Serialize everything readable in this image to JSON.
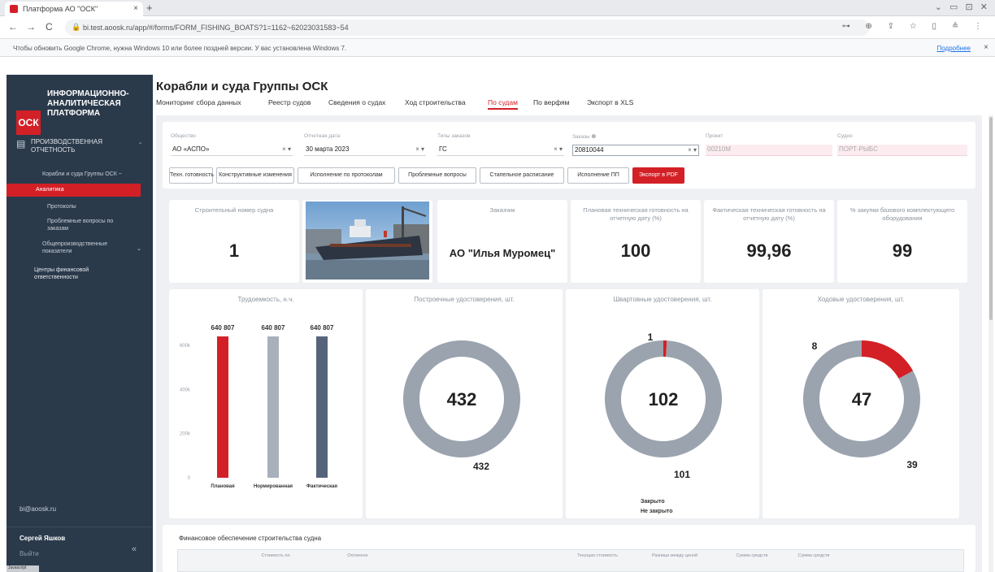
{
  "browser": {
    "tab_title": "Платформа АО \"ОСК\"",
    "tab_close": "×",
    "new_tab": "+",
    "window_controls": "⌄ ▭ ⊡ ✕",
    "back": "←",
    "forward": "→",
    "reload": "C",
    "url": "bi.test.aoosk.ru/app/#/forms/FORM_FISHING_BOATS?1=1162~62023031583~54",
    "toolbar_icons": "⊶ ⊕ ⇪ ☆ ▯ ≗ ⋮",
    "infobar_message": "Чтобы обновить Google Chrome, нужна Windows 10 или более поздней версии. У вас установлена Windows 7.",
    "infobar_more": "Подробнее",
    "infobar_close": "×"
  },
  "sidebar": {
    "logo_mark": "ОСК",
    "logo_text": "ИНФОРМАЦИОННО-АНАЛИТИЧЕСКАЯ ПЛАТФОРМА",
    "section_label": "ПРОИЗВОДСТВЕННАЯ ОТЧЕТНОСТЬ",
    "items": [
      {
        "label": "Корабли и суда Группы ОСК ~"
      },
      {
        "label": "Аналитика"
      },
      {
        "label": "Протоколы"
      },
      {
        "label": "Проблемные вопросы по заказам"
      },
      {
        "label": "Общепроизводственные показатели"
      },
      {
        "label": "Центры финансовой ответственности"
      }
    ],
    "email": "bi@aoosk.ru",
    "user_name": "Сергей Яшков",
    "logout": "Выйти",
    "collapse": "«",
    "footer_tag": "Javascript"
  },
  "header": {
    "title": "Корабли и суда Группы ОСК",
    "tabs": [
      {
        "label": "Мониторинг сбора данных"
      },
      {
        "label": "Реестр судов"
      },
      {
        "label": "Сведения о судах"
      },
      {
        "label": "Ход строительства"
      },
      {
        "label": "По судам"
      },
      {
        "label": "По верфям"
      },
      {
        "label": "Экспорт в XLS"
      }
    ],
    "active_tab": "По судам"
  },
  "filters": {
    "fields": [
      {
        "label": "Общество",
        "value": "АО «АСПО»",
        "controls": "×  ▾"
      },
      {
        "label": "Отчетная дата",
        "value": "30 марта 2023",
        "controls": "×  ▾"
      },
      {
        "label": "Типы заказов",
        "value": "ГС",
        "controls": "×  ▾"
      },
      {
        "label": "Заказы ❷",
        "value": "20810044",
        "controls": "×  ▾"
      },
      {
        "label": "Проект",
        "value": "00210М",
        "controls": ""
      },
      {
        "label": "Судно",
        "value": "ПОРТ-РЫБС",
        "controls": ""
      }
    ],
    "buttons": [
      {
        "label": "Техн. готовность"
      },
      {
        "label": "Конструктивные изменения"
      },
      {
        "label": "Исполнение по протоколам"
      },
      {
        "label": "Проблемные вопросы"
      },
      {
        "label": "Стапельное расписание"
      },
      {
        "label": "Исполнение ПП"
      },
      {
        "label": "Экспорт в PDF"
      }
    ]
  },
  "kpis": [
    {
      "label": "Строительный номер судна",
      "value": "1"
    },
    {
      "label": "Заказчик",
      "value": "АО \"Илья Муромец\""
    },
    {
      "label": "Плановая техническая готовность на отчетную дату (%)",
      "value": "100"
    },
    {
      "label": "Фактическая техническая готовность на отчетную дату (%)",
      "value": "99,96"
    },
    {
      "label": "% закупки базового комплектующего оборудования",
      "value": "99"
    }
  ],
  "colors": {
    "accent_red": "#d32027",
    "sidebar_bg": "#2b3a4b",
    "donut_grey": "#9aa3ae",
    "bar_grey": "#a7b0bb",
    "bar_dark": "#55647a"
  },
  "chart_data": [
    {
      "type": "bar",
      "title": "Трудоемкость, н.ч.",
      "categories": [
        "Плановая",
        "Нормированная",
        "Фактическая"
      ],
      "values": [
        640807,
        640807,
        640807
      ],
      "value_labels": [
        "640 807",
        "640 807",
        "640 807"
      ],
      "colors": [
        "#d32027",
        "#a7b0bb",
        "#55647a"
      ],
      "yticks": [
        0,
        200000,
        400000,
        600000
      ],
      "ytick_labels": [
        "0",
        "200k",
        "400k",
        "600k"
      ],
      "ylim": [
        0,
        700000
      ]
    },
    {
      "type": "pie",
      "title": "Построечные удостоверения, шт.",
      "center_label": "432",
      "slices": [
        {
          "name": "Закрыто",
          "value": 0,
          "label": "0",
          "color": "#d32027"
        },
        {
          "name": "Не закрыто",
          "value": 432,
          "label": "432",
          "color": "#9aa3ae"
        }
      ]
    },
    {
      "type": "pie",
      "title": "Швартовные удостоверения, шт.",
      "center_label": "102",
      "slices": [
        {
          "name": "Закрыто",
          "value": 1,
          "label": "1",
          "color": "#d32027"
        },
        {
          "name": "Не закрыто",
          "value": 101,
          "label": "101",
          "color": "#9aa3ae"
        }
      ],
      "legend": [
        "Закрыто",
        "Не закрыто"
      ]
    },
    {
      "type": "pie",
      "title": "Ходовые удостоверения, шт.",
      "center_label": "47",
      "slices": [
        {
          "name": "Закрыто",
          "value": 8,
          "label": "8",
          "color": "#d32027"
        },
        {
          "name": "Не закрыто",
          "value": 39,
          "label": "39",
          "color": "#9aa3ae"
        }
      ]
    }
  ],
  "finance": {
    "title": "Финансовое обеспечение строительства судна",
    "columns": [
      "Стоимость по",
      "Оплачено",
      "Текущая стоимость",
      "Разница между ценой",
      "Сумма средств",
      "Сумма средств"
    ]
  }
}
